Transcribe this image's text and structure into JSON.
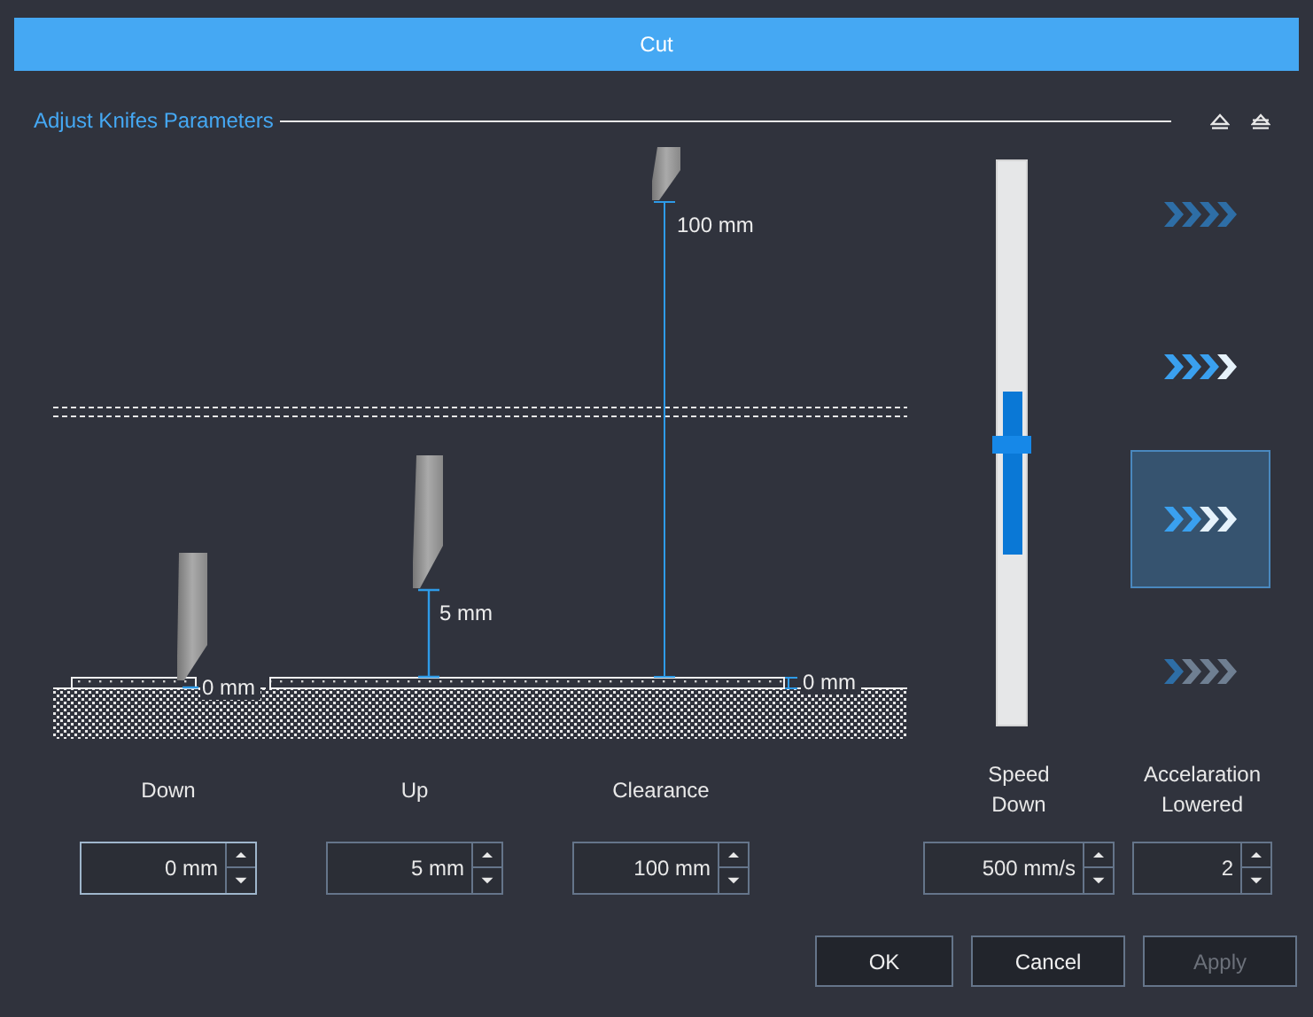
{
  "window": {
    "title": "Cut"
  },
  "section": {
    "title": "Adjust Knifes Parameters"
  },
  "diagram": {
    "down_reading": "0 mm",
    "up_reading": "5 mm",
    "clearance_reading": "100 mm",
    "material_reading": "0 mm"
  },
  "speed_slider": {
    "level": 0.5
  },
  "acceleration_options": [
    {
      "selected": false,
      "chevrons": [
        {
          "color": "#2e6ea6"
        },
        {
          "color": "#2e6ea6"
        },
        {
          "color": "#2e6ea6"
        },
        {
          "color": "#2e6ea6"
        }
      ]
    },
    {
      "selected": false,
      "chevrons": [
        {
          "color": "#3aa0ef"
        },
        {
          "color": "#3aa0ef"
        },
        {
          "color": "#3aa0ef"
        },
        {
          "color": "#e6f2fb"
        }
      ]
    },
    {
      "selected": true,
      "chevrons": [
        {
          "color": "#3aa0ef"
        },
        {
          "color": "#3aa0ef"
        },
        {
          "color": "#e6f2fb"
        },
        {
          "color": "#e6f2fb"
        }
      ]
    },
    {
      "selected": false,
      "chevrons": [
        {
          "color": "#2e6ea6"
        },
        {
          "color": "#6f7f92"
        },
        {
          "color": "#6f7f92"
        },
        {
          "color": "#6f7f92"
        }
      ]
    }
  ],
  "fields": [
    {
      "label": "Down",
      "value": "0 mm",
      "focused": true
    },
    {
      "label": "Up",
      "value": "5 mm",
      "focused": false
    },
    {
      "label": "Clearance",
      "value": "100 mm",
      "focused": false
    },
    {
      "label": "Speed Down",
      "value": "500 mm/s",
      "focused": false
    },
    {
      "label": "Accelaration Lowered",
      "value": "2",
      "focused": false
    }
  ],
  "buttons": [
    {
      "label": "OK",
      "disabled": false
    },
    {
      "label": "Cancel",
      "disabled": false
    },
    {
      "label": "Apply",
      "disabled": true
    }
  ]
}
